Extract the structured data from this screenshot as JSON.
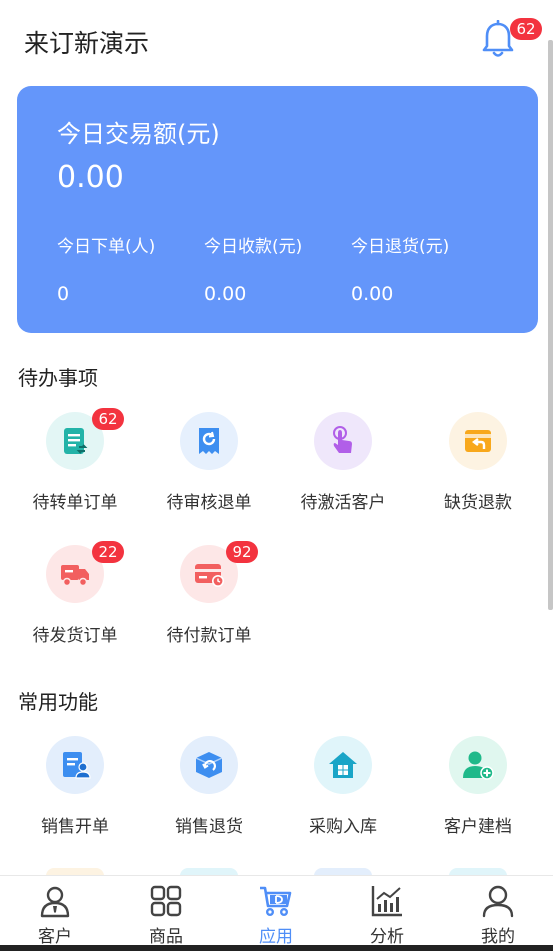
{
  "header": {
    "title": "来订新演示",
    "notification_count": "62"
  },
  "stats": {
    "title": "今日交易额(元)",
    "total": "0.00",
    "items": [
      {
        "label": "今日下单(人)",
        "value": "0"
      },
      {
        "label": "今日收款(元)",
        "value": "0.00"
      },
      {
        "label": "今日退货(元)",
        "value": "0.00"
      }
    ]
  },
  "todo": {
    "title": "待办事项",
    "items": [
      {
        "label": "待转单订单",
        "badge": "62",
        "icon": "order-transfer-icon"
      },
      {
        "label": "待审核退单",
        "badge": "",
        "icon": "refund-review-icon"
      },
      {
        "label": "待激活客户",
        "badge": "",
        "icon": "activate-customer-icon"
      },
      {
        "label": "缺货退款",
        "badge": "",
        "icon": "stockout-refund-icon"
      },
      {
        "label": "待发货订单",
        "badge": "22",
        "icon": "delivery-truck-icon"
      },
      {
        "label": "待付款订单",
        "badge": "92",
        "icon": "payment-card-icon"
      }
    ]
  },
  "common": {
    "title": "常用功能",
    "items": [
      {
        "label": "销售开单",
        "icon": "sales-order-icon"
      },
      {
        "label": "销售退货",
        "icon": "sales-return-icon"
      },
      {
        "label": "采购入库",
        "icon": "warehouse-icon"
      },
      {
        "label": "客户建档",
        "icon": "add-customer-icon"
      }
    ]
  },
  "tabbar": {
    "items": [
      {
        "label": "客户",
        "icon": "customer-icon"
      },
      {
        "label": "商品",
        "icon": "grid-icon"
      },
      {
        "label": "应用",
        "icon": "cart-icon",
        "active": true
      },
      {
        "label": "分析",
        "icon": "chart-icon"
      },
      {
        "label": "我的",
        "icon": "user-icon"
      }
    ]
  },
  "colors": {
    "accent": "#4f8ef7",
    "card": "#6496fa",
    "badge": "#f3333f"
  }
}
